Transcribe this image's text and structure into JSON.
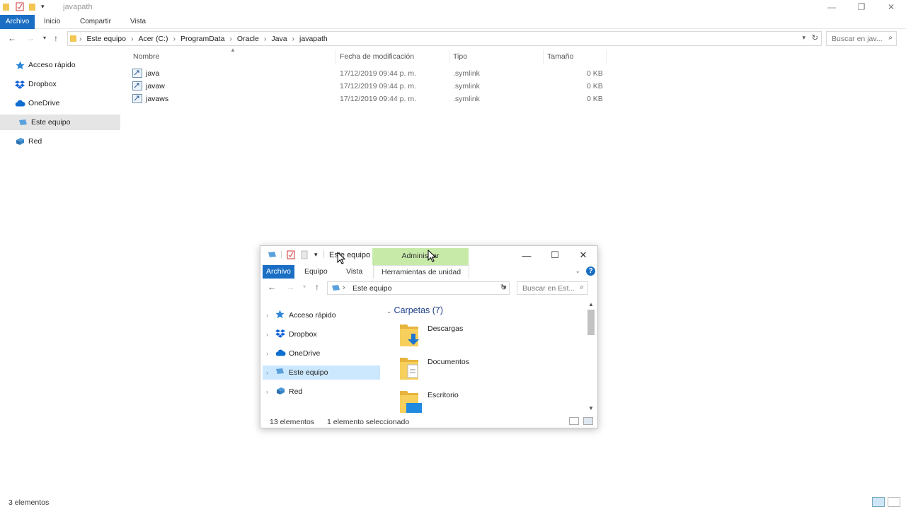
{
  "background_window": {
    "title": "javapath",
    "controls": [
      "—",
      "❐",
      "✕"
    ],
    "ribbon": {
      "file_tab": "Archivo",
      "tabs": [
        "Inicio",
        "Compartir",
        "Vista"
      ]
    },
    "breadcrumbs": [
      "Este equipo",
      "Acer (C:)",
      "ProgramData",
      "Oracle",
      "Java",
      "javapath"
    ],
    "search_placeholder": "Buscar en jav...",
    "sidebar": [
      {
        "label": "Acceso rápido",
        "icon": "star-icon"
      },
      {
        "label": "Dropbox",
        "icon": "dropbox-icon"
      },
      {
        "label": "OneDrive",
        "icon": "cloud-icon"
      },
      {
        "label": "Este equipo",
        "icon": "computer-icon",
        "selected": true
      },
      {
        "label": "Red",
        "icon": "network-icon"
      }
    ],
    "columns": {
      "name": "Nombre",
      "modified": "Fecha de modificación",
      "type": "Tipo",
      "size": "Tamaño"
    },
    "files": [
      {
        "name": "java",
        "modified": "17/12/2019 09:44 p. m.",
        "type": ".symlink",
        "size": "0 KB"
      },
      {
        "name": "javaw",
        "modified": "17/12/2019 09:44 p. m.",
        "type": ".symlink",
        "size": "0 KB"
      },
      {
        "name": "javaws",
        "modified": "17/12/2019 09:44 p. m.",
        "type": ".symlink",
        "size": "0 KB"
      }
    ],
    "status": "3 elementos"
  },
  "foreground_window": {
    "title": "Este equipo",
    "manage_tab": "Administrar",
    "controls": [
      "—",
      "☐",
      "✕"
    ],
    "ribbon": {
      "file_tab": "Archivo",
      "tabs": [
        "Equipo",
        "Vista"
      ],
      "tools_tab": "Herramientas de unidad"
    },
    "address": "Este equipo",
    "search_placeholder": "Buscar en Est...",
    "sidebar": [
      {
        "label": "Acceso rápido",
        "icon": "star-icon"
      },
      {
        "label": "Dropbox",
        "icon": "dropbox-icon"
      },
      {
        "label": "OneDrive",
        "icon": "cloud-icon"
      },
      {
        "label": "Este equipo",
        "icon": "computer-icon",
        "selected": true
      },
      {
        "label": "Red",
        "icon": "network-icon"
      }
    ],
    "group_header": "Carpetas (7)",
    "folders": [
      {
        "name": "Descargas",
        "icon": "downloads-folder-icon"
      },
      {
        "name": "Documentos",
        "icon": "documents-folder-icon"
      },
      {
        "name": "Escritorio",
        "icon": "desktop-folder-icon"
      }
    ],
    "status_count": "13 elementos",
    "status_selected": "1 elemento seleccionado"
  },
  "colors": {
    "accent": "#1a6fc4",
    "manage_tab": "#c8eaa9",
    "selection": "#cce8ff",
    "folder": "#f3c654"
  }
}
